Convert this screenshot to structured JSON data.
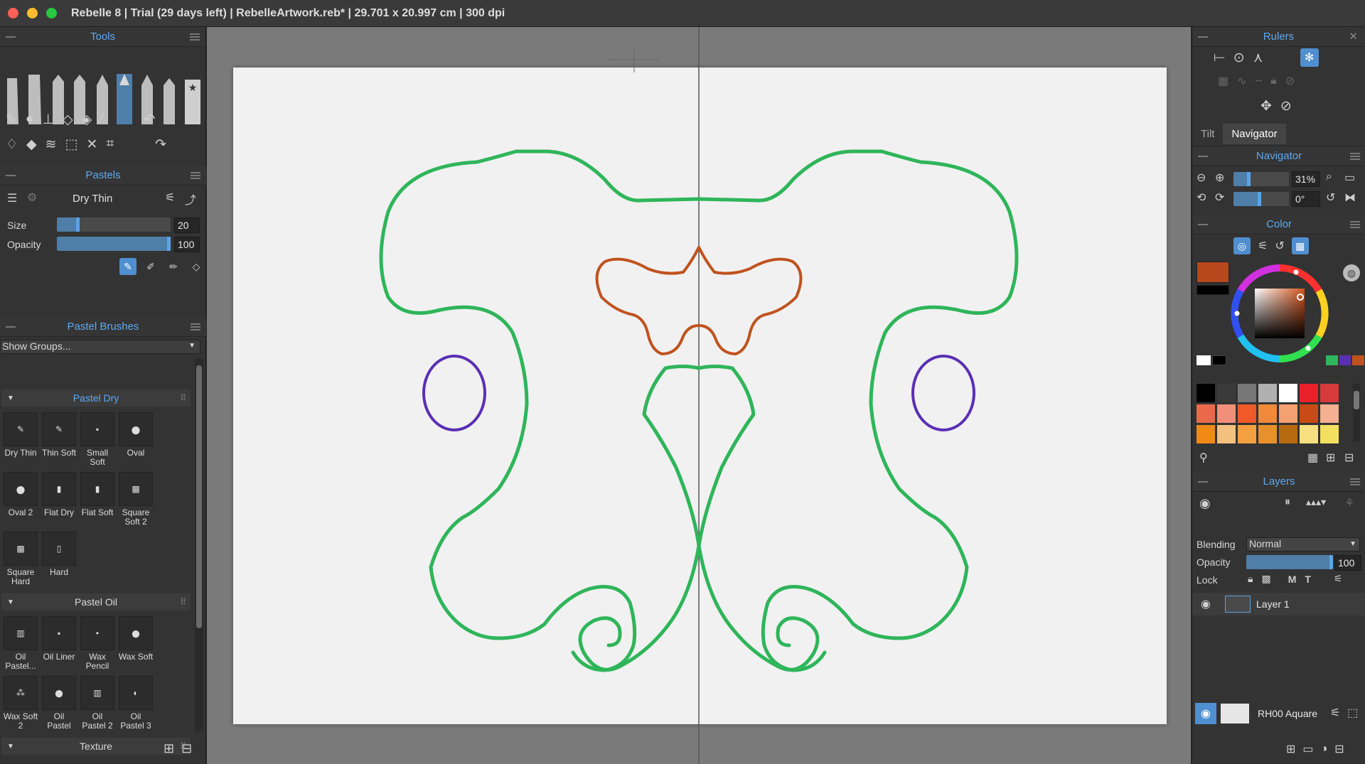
{
  "window": {
    "title": "Rebelle 8 | Trial (29 days left) | RebelleArtwork.reb* | 29.701 x 20.997 cm | 300 dpi"
  },
  "tools_panel": {
    "title": "Tools"
  },
  "pastels_panel": {
    "title": "Pastels",
    "brush_name": "Dry Thin",
    "size_label": "Size",
    "size_value": "20",
    "size_level": 0.2,
    "opacity_label": "Opacity",
    "opacity_value": "100",
    "opacity_level": 1.0
  },
  "brushes_panel": {
    "title": "Pastel Brushes",
    "show_groups": "Show Groups...",
    "groups": [
      {
        "name": "Pastel Dry",
        "items": [
          "Dry Thin",
          "Thin Soft",
          "Small Soft",
          "Oval",
          "Oval 2",
          "Flat Dry",
          "Flat Soft",
          "Square Soft 2",
          "Square Hard",
          "Hard"
        ]
      },
      {
        "name": "Pastel Oil",
        "items": [
          "Oil Pastel...",
          "Oil Liner",
          "Wax Pencil",
          "Wax Soft",
          "Wax Soft 2",
          "Oil Pastel",
          "Oil Pastel 2",
          "Oil Pastel 3"
        ]
      },
      {
        "name": "Texture",
        "items": []
      }
    ]
  },
  "rulers_panel": {
    "title": "Rulers"
  },
  "tabs": [
    "Tilt",
    "Navigator"
  ],
  "navigator_panel": {
    "title": "Navigator",
    "zoom": "31%",
    "zoom_level": 0.31,
    "rotation": "0°"
  },
  "color_panel": {
    "title": "Color",
    "primary_color": "#b5481c",
    "secondary_color": "#000000",
    "palette": [
      [
        "#000000",
        "#3a3a3a",
        "#777777",
        "#b0b0b0",
        "#ffffff",
        "#e8202a",
        "#d83a3a"
      ],
      [
        "#e86a4a",
        "#f0907a",
        "#f05a28",
        "#f08a3a",
        "#f4a070",
        "#c84a14",
        "#f4b090"
      ],
      [
        "#f08a14",
        "#f4c080",
        "#f4a040",
        "#e8902a",
        "#b86a10",
        "#f8e080",
        "#f4e060"
      ]
    ]
  },
  "layers_panel": {
    "title": "Layers",
    "blending_label": "Blending",
    "blending_value": "Normal",
    "opacity_label": "Opacity",
    "opacity_value": "100",
    "opacity_level": 1.0,
    "lock_label": "Lock",
    "layer_name": "Layer 1",
    "paper_name": "RH00 Aquare"
  },
  "canvas": {
    "stroke_green": "#2fb55a",
    "stroke_orange": "#c0521e",
    "stroke_purple": "#5a2fb5"
  }
}
